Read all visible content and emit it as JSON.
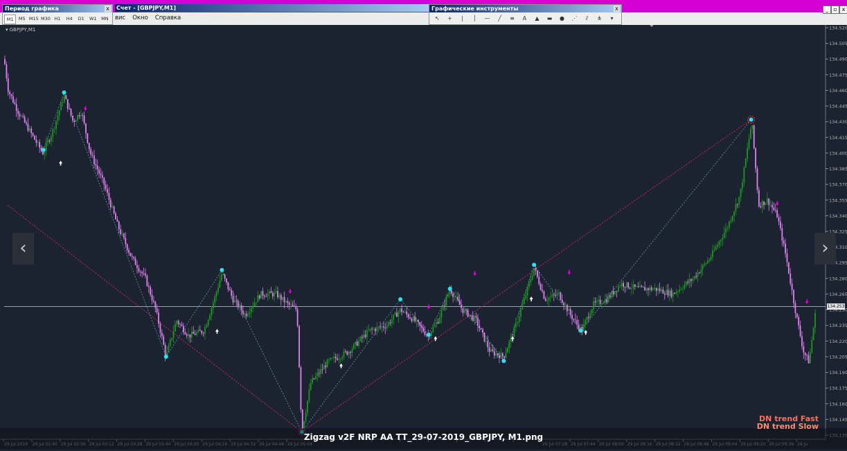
{
  "window": {
    "period_panel_title": "Период графика",
    "chart_window_title": "Счет - [GBPJPY,M1]",
    "tools_panel_title": "Графические инструменты",
    "close_glyph": "x",
    "minimize_glyph": "_",
    "restore_glyph": "▫",
    "close_window_glyph": "x"
  },
  "timeframes": [
    {
      "label": "M1",
      "active": true
    },
    {
      "label": "M5",
      "active": false
    },
    {
      "label": "M15",
      "active": false
    },
    {
      "label": "M30",
      "active": false
    },
    {
      "label": "H1",
      "active": false
    },
    {
      "label": "H4",
      "active": false
    },
    {
      "label": "D1",
      "active": false
    },
    {
      "label": "W1",
      "active": false
    },
    {
      "label": "MN",
      "active": false
    }
  ],
  "menu": [
    "вис",
    "Окно",
    "Справка"
  ],
  "drawing_tools": [
    {
      "name": "cursor-tool-icon",
      "glyph": "↖"
    },
    {
      "name": "crosshair-tool-icon",
      "glyph": "+"
    },
    {
      "name": "separator-icon",
      "glyph": "|"
    },
    {
      "name": "vertical-line-tool-icon",
      "glyph": "│"
    },
    {
      "name": "horizontal-line-tool-icon",
      "glyph": "—"
    },
    {
      "name": "trendline-tool-icon",
      "glyph": "╱"
    },
    {
      "name": "fibo-tool-icon",
      "glyph": "≡"
    },
    {
      "name": "text-tool-icon",
      "glyph": "A"
    },
    {
      "name": "triangle-tool-icon",
      "glyph": "▲"
    },
    {
      "name": "rectangle-tool-icon",
      "glyph": "▬"
    },
    {
      "name": "ellipse-tool-icon",
      "glyph": "●"
    },
    {
      "name": "gann-fan-tool-icon",
      "glyph": "⋰"
    },
    {
      "name": "channel-tool-icon",
      "glyph": "⫽"
    },
    {
      "name": "pitchfork-tool-icon",
      "glyph": "⋔"
    },
    {
      "name": "more-tools-icon",
      "glyph": "▾"
    }
  ],
  "chart": {
    "symbol_label": "▾ GBPJPY,M1",
    "caption": "Zigzag v2F NRP AA TT_29-07-2019_GBPJPY, M1.png",
    "legend_fast": "DN trend Fast",
    "legend_slow": "DN trend Slow",
    "current_price": "134.253",
    "nav_prev_glyph": "‹",
    "nav_next_glyph": "›",
    "colors": {
      "background": "#1b2230",
      "candle_bear": "#e27ff2",
      "candle_bull": "#1a9a1a",
      "zigzag_points": "#29e0f5",
      "slow_zigzag": "#c8285a",
      "fast_zigzag": "#5d8fa6",
      "up_arrow": "#ffffff",
      "down_arrow": "#e000e0",
      "price_line": "#aab4c0",
      "axis_text": "#b4b4b4"
    }
  },
  "chart_data": {
    "type": "candlestick",
    "symbol": "GBPJPY",
    "timeframe": "M1",
    "ylim": [
      134.13,
      134.52
    ],
    "y_ticks": [
      134.52,
      134.505,
      134.49,
      134.475,
      134.46,
      134.445,
      134.43,
      134.415,
      134.4,
      134.385,
      134.37,
      134.355,
      134.34,
      134.325,
      134.31,
      134.295,
      134.28,
      134.265,
      134.25,
      134.235,
      134.22,
      134.205,
      134.19,
      134.175,
      134.16,
      134.145,
      134.13
    ],
    "y_tick_labels": [
      "134.520",
      "134.505",
      "134.490",
      "134.475",
      "134.460",
      "134.445",
      "134.430",
      "134.415",
      "134.400",
      "134.385",
      "134.370",
      "134.355",
      "134.340",
      "134.325",
      "134.310",
      "134.295",
      "134.280",
      "134.265",
      "134.250",
      "134.235",
      "134.220",
      "134.205",
      "134.190",
      "134.175",
      "134.160",
      "134.145",
      "134.130"
    ],
    "x_tick_labels": [
      "29 Jul 2019",
      "29 Jul 02:40",
      "29 Jul 02:56",
      "29 Jul 03:12",
      "29 Jul 03:28",
      "29 Jul 03:44",
      "29 Jul 04:00",
      "29 Jul 04:16",
      "29 Jul 04:32",
      "29 Jul 04:48",
      "29 Jul 05:04",
      "",
      "",
      "",
      "",
      "",
      "",
      "",
      "",
      "29 Jul 07:28",
      "29 Jul 07:44",
      "29 Jul 08:00",
      "29 Jul 08:16",
      "29 Jul 08:32",
      "29 Jul 08:48",
      "29 Jul 09:04",
      "29 Jul 09:20",
      "29 Jul 09:36",
      "29 Ju"
    ],
    "current_price": 134.253,
    "price_path": [
      [
        0,
        134.49
      ],
      [
        6,
        134.46
      ],
      [
        20,
        134.44
      ],
      [
        38,
        134.42
      ],
      [
        56,
        134.4
      ],
      [
        70,
        134.42
      ],
      [
        87,
        134.455
      ],
      [
        100,
        134.43
      ],
      [
        112,
        134.44
      ],
      [
        125,
        134.4
      ],
      [
        145,
        134.37
      ],
      [
        165,
        134.33
      ],
      [
        185,
        134.3
      ],
      [
        205,
        134.28
      ],
      [
        220,
        134.25
      ],
      [
        235,
        134.205
      ],
      [
        250,
        134.24
      ],
      [
        268,
        134.225
      ],
      [
        290,
        134.23
      ],
      [
        305,
        134.26
      ],
      [
        316,
        134.285
      ],
      [
        332,
        134.26
      ],
      [
        350,
        134.245
      ],
      [
        372,
        134.265
      ],
      [
        395,
        134.265
      ],
      [
        412,
        134.255
      ],
      [
        425,
        134.25
      ],
      [
        432,
        134.133
      ],
      [
        445,
        134.18
      ],
      [
        470,
        134.2
      ],
      [
        500,
        134.21
      ],
      [
        530,
        134.23
      ],
      [
        555,
        134.235
      ],
      [
        575,
        134.25
      ],
      [
        595,
        134.24
      ],
      [
        615,
        134.225
      ],
      [
        630,
        134.24
      ],
      [
        647,
        134.27
      ],
      [
        665,
        134.25
      ],
      [
        685,
        134.24
      ],
      [
        705,
        134.21
      ],
      [
        725,
        134.205
      ],
      [
        740,
        134.23
      ],
      [
        755,
        134.26
      ],
      [
        769,
        134.29
      ],
      [
        785,
        134.26
      ],
      [
        805,
        134.265
      ],
      [
        822,
        134.245
      ],
      [
        838,
        134.23
      ],
      [
        855,
        134.255
      ],
      [
        875,
        134.26
      ],
      [
        895,
        134.275
      ],
      [
        920,
        134.27
      ],
      [
        945,
        134.27
      ],
      [
        970,
        134.265
      ],
      [
        1000,
        134.28
      ],
      [
        1025,
        134.3
      ],
      [
        1050,
        134.33
      ],
      [
        1068,
        134.36
      ],
      [
        1085,
        134.43
      ],
      [
        1095,
        134.35
      ],
      [
        1108,
        134.355
      ],
      [
        1122,
        134.34
      ],
      [
        1135,
        134.3
      ],
      [
        1148,
        134.25
      ],
      [
        1160,
        134.21
      ],
      [
        1168,
        134.2
      ],
      [
        1178,
        134.25
      ]
    ],
    "zigzag_fast_points": [
      [
        57,
        134.403
      ],
      [
        87,
        134.458
      ],
      [
        235,
        134.205
      ],
      [
        316,
        134.288
      ],
      [
        432,
        134.133
      ],
      [
        575,
        134.26
      ],
      [
        616,
        134.226
      ],
      [
        647,
        134.27
      ],
      [
        725,
        134.201
      ],
      [
        769,
        134.293
      ],
      [
        837,
        134.23
      ],
      [
        1084,
        134.432
      ]
    ],
    "zigzag_slow_points": [
      [
        5,
        134.35
      ],
      [
        432,
        134.133
      ],
      [
        1084,
        134.432
      ]
    ],
    "up_arrows": [
      [
        82,
        134.39
      ],
      [
        309,
        134.229
      ],
      [
        489,
        134.196
      ],
      [
        626,
        134.222
      ],
      [
        738,
        134.222
      ],
      [
        765,
        134.26
      ],
      [
        844,
        134.228
      ]
    ],
    "down_arrows": [
      [
        118,
        134.443
      ],
      [
        415,
        134.268
      ],
      [
        616,
        134.253
      ],
      [
        683,
        134.285
      ],
      [
        820,
        134.286
      ],
      [
        1122,
        134.352
      ],
      [
        1165,
        134.258
      ]
    ],
    "legend": [
      "DN trend Fast",
      "DN trend Slow"
    ]
  }
}
